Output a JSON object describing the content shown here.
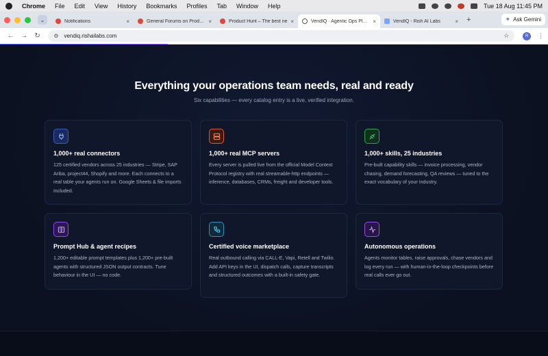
{
  "menubar": {
    "app": "Chrome",
    "items": [
      "File",
      "Edit",
      "View",
      "History",
      "Bookmarks",
      "Profiles",
      "Tab",
      "Window",
      "Help"
    ],
    "datetime": "Tue 18 Aug  11:45 PM"
  },
  "tabs": [
    {
      "title": "Notifications",
      "favicon": "producthunt-icon"
    },
    {
      "title": "General Forums on Product",
      "favicon": "producthunt-icon"
    },
    {
      "title": "Product Hunt – The best ne",
      "favicon": "producthunt-icon"
    },
    {
      "title": "VendIQ · Agentic Ops Platfo",
      "favicon": "globe-icon"
    },
    {
      "title": "VendIQ - Rish AI Labs",
      "favicon": "rish-icon"
    }
  ],
  "toolbar": {
    "ask_gemini": "Ask Gemini",
    "url": "vendiq.rishailabs.com",
    "profile_initial": "R"
  },
  "section": {
    "title": "Everything your operations team needs, real and ready",
    "subtitle": "Six capabilities — every catalog entry is a live, verified integration."
  },
  "cards": [
    {
      "icon": "plug-icon",
      "color": "#3b5cc7",
      "title": "1,000+ real connectors",
      "desc": "125 certified vendors across 25 industries — Stripe, SAP Ariba, project44, Shopify and more. Each connects to a real table your agents run on. Google Sheets & file imports included."
    },
    {
      "icon": "server-icon",
      "color": "#e2572b",
      "title": "1,000+ real MCP servers",
      "desc": "Every server is pulled live from the official Model Context Protocol registry with real streamable-http endpoints — inference, databases, CRMs, freight and developer tools."
    },
    {
      "icon": "puzzle-icon",
      "color": "#2aa34f",
      "title": "1,000+ skills, 25 industries",
      "desc": "Pre-built capability skills — invoice processing, vendor chasing, demand forecasting, QA reviews — tuned to the exact vocabulary of your industry."
    },
    {
      "icon": "book-icon",
      "color": "#8a4df0",
      "title": "Prompt Hub & agent recipes",
      "desc": "1,200+ editable prompt templates plus 1,200+ pre-built agents with structured JSON output contracts. Tune behaviour in the UI — no code."
    },
    {
      "icon": "phone-icon",
      "color": "#2a93bf",
      "title": "Certified voice marketplace",
      "desc": "Real outbound calling via CALL-E, Vapi, Retell and Twilio. Add API keys in the UI, dispatch calls, capture transcripts and structured outcomes with a built-in safety gate."
    },
    {
      "icon": "activity-icon",
      "color": "#9350e6",
      "title": "Autonomous operations",
      "desc": "Agents monitor tables, raise approvals, chase vendors and log every run — with human-in-the-loop checkpoints before real calls ever go out."
    }
  ]
}
